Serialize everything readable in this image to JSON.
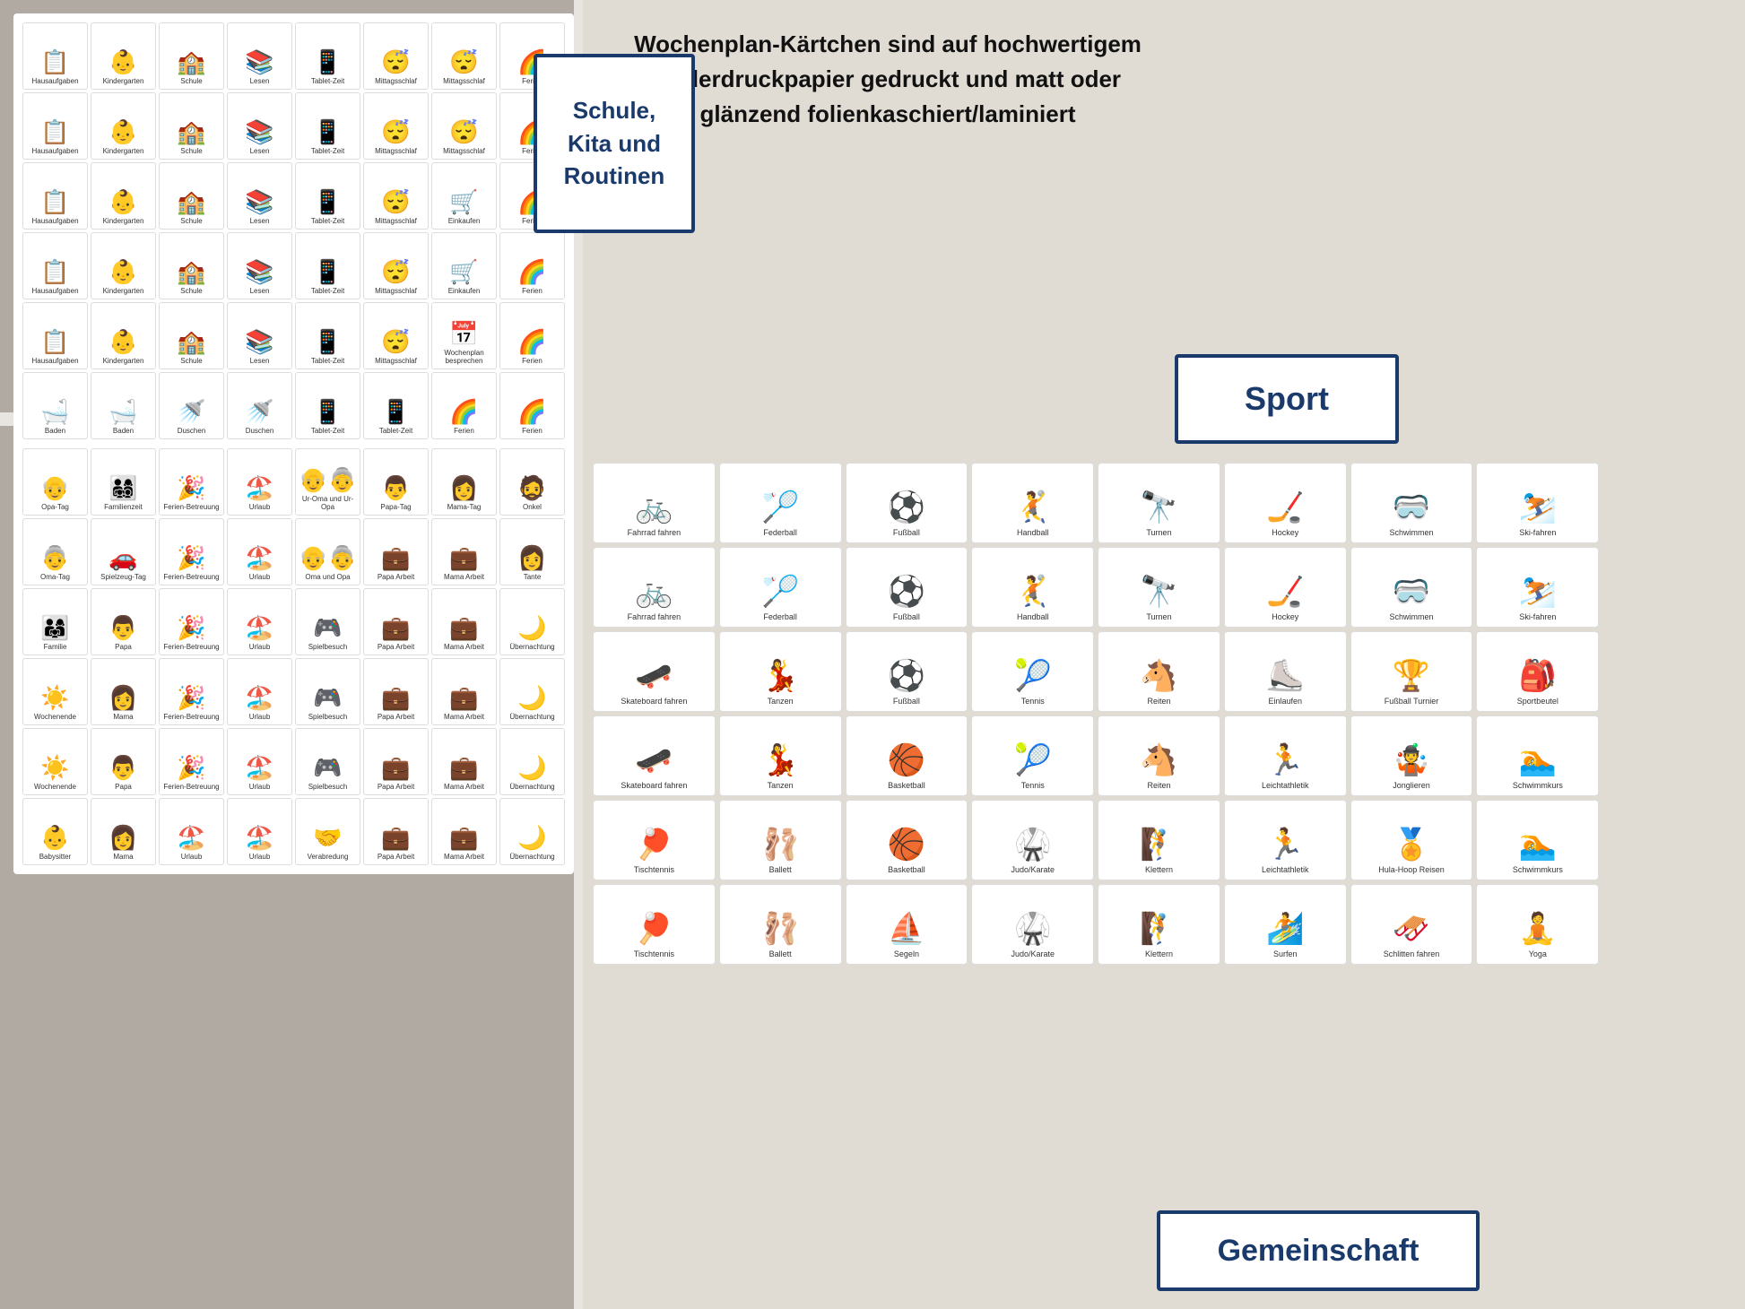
{
  "header": {
    "description": "Wochenplan-Kärtchen sind auf hochwertigem Bilderdruckpapier gedruckt und matt oder glänzend folienkaschiert/laminiert"
  },
  "badges": {
    "schule": "Schule,\nKita und\nRoutinen",
    "sport": "Sport",
    "gemeinschaft": "Gemeinschaft"
  },
  "school_rows": [
    [
      {
        "icon": "📋",
        "label": "Hausaufgaben"
      },
      {
        "icon": "👶",
        "label": "Kindergarten"
      },
      {
        "icon": "🏫",
        "label": "Schule"
      },
      {
        "icon": "📚",
        "label": "Lesen"
      },
      {
        "icon": "📱",
        "label": "Tablet-Zeit"
      },
      {
        "icon": "😴",
        "label": "Mittagsschlaf"
      },
      {
        "icon": "😴",
        "label": "Mittagsschlaf"
      },
      {
        "icon": "🌈",
        "label": "Ferien"
      }
    ],
    [
      {
        "icon": "📋",
        "label": "Hausaufgaben"
      },
      {
        "icon": "👶",
        "label": "Kindergarten"
      },
      {
        "icon": "🏫",
        "label": "Schule"
      },
      {
        "icon": "📚",
        "label": "Lesen"
      },
      {
        "icon": "📱",
        "label": "Tablet-Zeit"
      },
      {
        "icon": "😴",
        "label": "Mittagsschlaf"
      },
      {
        "icon": "😴",
        "label": "Mittagsschlaf"
      },
      {
        "icon": "🌈",
        "label": "Ferien"
      }
    ],
    [
      {
        "icon": "📋",
        "label": "Hausaufgaben"
      },
      {
        "icon": "👶",
        "label": "Kindergarten"
      },
      {
        "icon": "🏫",
        "label": "Schule"
      },
      {
        "icon": "📚",
        "label": "Lesen"
      },
      {
        "icon": "📱",
        "label": "Tablet-Zeit"
      },
      {
        "icon": "😴",
        "label": "Mittagsschlaf"
      },
      {
        "icon": "🛒",
        "label": "Einkaufen"
      },
      {
        "icon": "🌈",
        "label": "Ferien"
      }
    ],
    [
      {
        "icon": "📋",
        "label": "Hausaufgaben"
      },
      {
        "icon": "👶",
        "label": "Kindergarten"
      },
      {
        "icon": "🏫",
        "label": "Schule"
      },
      {
        "icon": "📚",
        "label": "Lesen"
      },
      {
        "icon": "📱",
        "label": "Tablet-Zeit"
      },
      {
        "icon": "😴",
        "label": "Mittagsschlaf"
      },
      {
        "icon": "🛒",
        "label": "Einkaufen"
      },
      {
        "icon": "🌈",
        "label": "Ferien"
      }
    ],
    [
      {
        "icon": "📋",
        "label": "Hausaufgaben"
      },
      {
        "icon": "👶",
        "label": "Kindergarten"
      },
      {
        "icon": "🏫",
        "label": "Schule"
      },
      {
        "icon": "📚",
        "label": "Lesen"
      },
      {
        "icon": "📱",
        "label": "Tablet-Zeit"
      },
      {
        "icon": "😴",
        "label": "Mittagsschlaf"
      },
      {
        "icon": "📅",
        "label": "Wochenplan besprechen"
      },
      {
        "icon": "🌈",
        "label": "Ferien"
      }
    ],
    [
      {
        "icon": "🛁",
        "label": "Baden"
      },
      {
        "icon": "🛁",
        "label": "Baden"
      },
      {
        "icon": "🚿",
        "label": "Duschen"
      },
      {
        "icon": "🚿",
        "label": "Duschen"
      },
      {
        "icon": "📱",
        "label": "Tablet-Zeit"
      },
      {
        "icon": "📱",
        "label": "Tablet-Zeit"
      },
      {
        "icon": "🌈",
        "label": "Ferien"
      },
      {
        "icon": "🌈",
        "label": "Ferien"
      }
    ]
  ],
  "family_rows": [
    [
      {
        "icon": "👴",
        "label": "Opa-Tag"
      },
      {
        "icon": "👨‍👩‍👧‍👦",
        "label": "Familienzeit"
      },
      {
        "icon": "🎉",
        "label": "Ferien-Betreuung"
      },
      {
        "icon": "🏖️",
        "label": "Urlaub"
      },
      {
        "icon": "👴👵",
        "label": "Ur-Oma und Ur-Opa"
      },
      {
        "icon": "👨",
        "label": "Papa-Tag"
      },
      {
        "icon": "👩",
        "label": "Mama-Tag"
      },
      {
        "icon": "🧔",
        "label": "Onkel"
      }
    ],
    [
      {
        "icon": "👵",
        "label": "Oma-Tag"
      },
      {
        "icon": "🚗",
        "label": "Spielzeug-Tag"
      },
      {
        "icon": "🎉",
        "label": "Ferien-Betreuung"
      },
      {
        "icon": "🏖️",
        "label": "Urlaub"
      },
      {
        "icon": "👴👵",
        "label": "Oma und Opa"
      },
      {
        "icon": "💼",
        "label": "Papa Arbeit"
      },
      {
        "icon": "💼",
        "label": "Mama Arbeit"
      },
      {
        "icon": "👩",
        "label": "Tante"
      }
    ],
    [
      {
        "icon": "👨‍👩‍👧",
        "label": "Familie"
      },
      {
        "icon": "👨",
        "label": "Papa"
      },
      {
        "icon": "🎉",
        "label": "Ferien-Betreuung"
      },
      {
        "icon": "🏖️",
        "label": "Urlaub"
      },
      {
        "icon": "🎮",
        "label": "Spielbesuch"
      },
      {
        "icon": "💼",
        "label": "Papa Arbeit"
      },
      {
        "icon": "💼",
        "label": "Mama Arbeit"
      },
      {
        "icon": "🌙",
        "label": "Übernachtung"
      }
    ],
    [
      {
        "icon": "☀️",
        "label": "Wochenende"
      },
      {
        "icon": "👩",
        "label": "Mama"
      },
      {
        "icon": "🎉",
        "label": "Ferien-Betreuung"
      },
      {
        "icon": "🏖️",
        "label": "Urlaub"
      },
      {
        "icon": "🎮",
        "label": "Spielbesuch"
      },
      {
        "icon": "💼",
        "label": "Papa Arbeit"
      },
      {
        "icon": "💼",
        "label": "Mama Arbeit"
      },
      {
        "icon": "🌙",
        "label": "Übernachtung"
      }
    ],
    [
      {
        "icon": "☀️",
        "label": "Wochenende"
      },
      {
        "icon": "👨",
        "label": "Papa"
      },
      {
        "icon": "🎉",
        "label": "Ferien-Betreuung"
      },
      {
        "icon": "🏖️",
        "label": "Urlaub"
      },
      {
        "icon": "🎮",
        "label": "Spielbesuch"
      },
      {
        "icon": "💼",
        "label": "Papa Arbeit"
      },
      {
        "icon": "💼",
        "label": "Mama Arbeit"
      },
      {
        "icon": "🌙",
        "label": "Übernachtung"
      }
    ],
    [
      {
        "icon": "👶",
        "label": "Babysitter"
      },
      {
        "icon": "👩",
        "label": "Mama"
      },
      {
        "icon": "🏖️",
        "label": "Urlaub"
      },
      {
        "icon": "🏖️",
        "label": "Urlaub"
      },
      {
        "icon": "🤝",
        "label": "Verabredung"
      },
      {
        "icon": "💼",
        "label": "Papa Arbeit"
      },
      {
        "icon": "💼",
        "label": "Mama Arbeit"
      },
      {
        "icon": "🌙",
        "label": "Übernachtung"
      }
    ]
  ],
  "sport_rows": [
    [
      {
        "icon": "🚲",
        "label": "Fahrrad fahren"
      },
      {
        "icon": "🏸",
        "label": "Federball"
      },
      {
        "icon": "⚽",
        "label": "Fußball"
      },
      {
        "icon": "🤾",
        "label": "Handball"
      },
      {
        "icon": "🔭",
        "label": "Turnen"
      },
      {
        "icon": "🏒",
        "label": "Hockey"
      },
      {
        "icon": "🥽",
        "label": "Schwimmen"
      },
      {
        "icon": "⛷️",
        "label": "Ski-fahren"
      },
      {
        "icon": "",
        "label": ""
      }
    ],
    [
      {
        "icon": "🚲",
        "label": "Fahrrad fahren"
      },
      {
        "icon": "🏸",
        "label": "Federball"
      },
      {
        "icon": "⚽",
        "label": "Fußball"
      },
      {
        "icon": "🤾",
        "label": "Handball"
      },
      {
        "icon": "🔭",
        "label": "Turnen"
      },
      {
        "icon": "🏒",
        "label": "Hockey"
      },
      {
        "icon": "🥽",
        "label": "Schwimmen"
      },
      {
        "icon": "⛷️",
        "label": "Ski-fahren"
      },
      {
        "icon": "",
        "label": ""
      }
    ],
    [
      {
        "icon": "🛹",
        "label": "Skateboard fahren"
      },
      {
        "icon": "💃",
        "label": "Tanzen"
      },
      {
        "icon": "⚽",
        "label": "Fußball"
      },
      {
        "icon": "🎾",
        "label": "Tennis"
      },
      {
        "icon": "🐴",
        "label": "Reiten"
      },
      {
        "icon": "⛸️",
        "label": "Einlaufen"
      },
      {
        "icon": "🏆",
        "label": "Fußball Turnier"
      },
      {
        "icon": "🎒",
        "label": "Sportbeutel"
      },
      {
        "icon": "",
        "label": ""
      }
    ],
    [
      {
        "icon": "🛹",
        "label": "Skateboard fahren"
      },
      {
        "icon": "💃",
        "label": "Tanzen"
      },
      {
        "icon": "🏀",
        "label": "Basketball"
      },
      {
        "icon": "🎾",
        "label": "Tennis"
      },
      {
        "icon": "🐴",
        "label": "Reiten"
      },
      {
        "icon": "🏃",
        "label": "Leichtathletik"
      },
      {
        "icon": "🤹",
        "label": "Jonglieren"
      },
      {
        "icon": "🏊",
        "label": "Schwimmkurs"
      },
      {
        "icon": "",
        "label": ""
      }
    ],
    [
      {
        "icon": "🏓",
        "label": "Tischtennis"
      },
      {
        "icon": "🩰",
        "label": "Ballett"
      },
      {
        "icon": "🏀",
        "label": "Basketball"
      },
      {
        "icon": "🥋",
        "label": "Judo/Karate"
      },
      {
        "icon": "🧗",
        "label": "Klettern"
      },
      {
        "icon": "🏃",
        "label": "Leichtathletik"
      },
      {
        "icon": "🏅",
        "label": "Hula-Hoop Reisen"
      },
      {
        "icon": "🏊",
        "label": "Schwimmkurs"
      },
      {
        "icon": "",
        "label": ""
      }
    ],
    [
      {
        "icon": "🏓",
        "label": "Tischtennis"
      },
      {
        "icon": "🩰",
        "label": "Ballett"
      },
      {
        "icon": "⛵",
        "label": "Segeln"
      },
      {
        "icon": "🥋",
        "label": "Judo/Karate"
      },
      {
        "icon": "🧗",
        "label": "Klettern"
      },
      {
        "icon": "🏄",
        "label": "Surfen"
      },
      {
        "icon": "🛷",
        "label": "Schlitten fahren"
      },
      {
        "icon": "🧘",
        "label": "Yoga"
      },
      {
        "icon": "",
        "label": ""
      }
    ]
  ]
}
